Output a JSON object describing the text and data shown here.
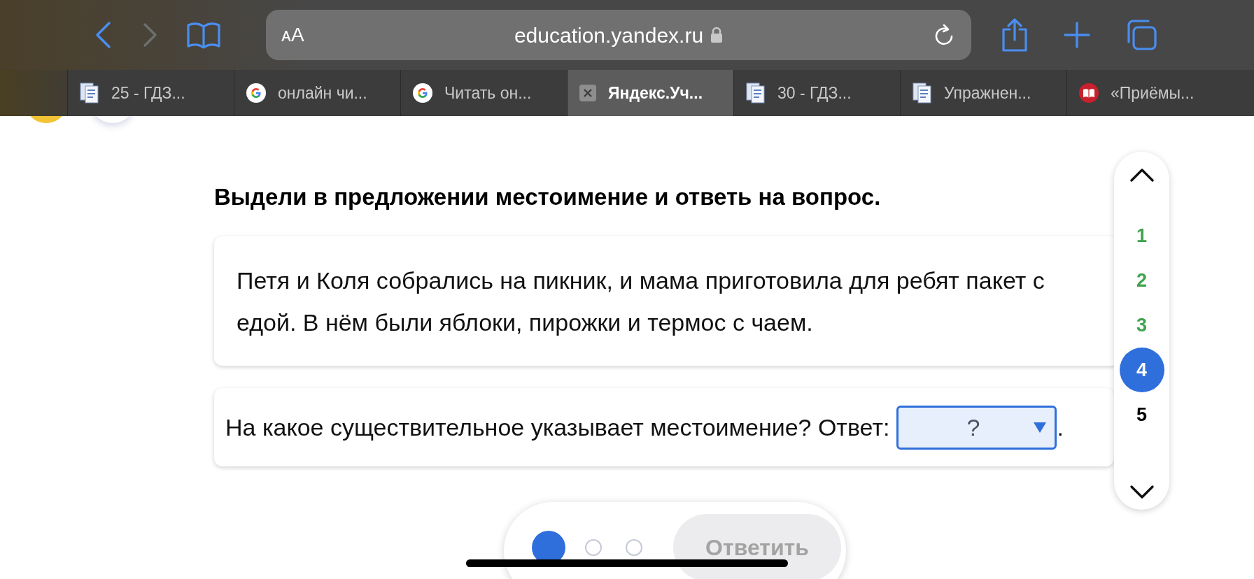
{
  "browser": {
    "text_size_button": "ᴀA",
    "url": "education.yandex.ru",
    "tabs": [
      {
        "title": "25 - ГДЗ...",
        "kind": "doc",
        "selected": false
      },
      {
        "title": "онлайн чи...",
        "kind": "google",
        "selected": false
      },
      {
        "title": "Читать он...",
        "kind": "google",
        "selected": false
      },
      {
        "title": "Яндекс.Уч...",
        "kind": "close",
        "selected": true
      },
      {
        "title": "30 - ГДЗ...",
        "kind": "doc",
        "selected": false
      },
      {
        "title": "Упражнен...",
        "kind": "doc",
        "selected": false
      },
      {
        "title": "«Приёмы...",
        "kind": "book",
        "selected": false
      }
    ]
  },
  "task": {
    "instruction": "Выдели в предложении местоимение и ответь на вопрос.",
    "passage": "Петя и Коля собрались на пикник, и мама приготовила для ребят пакет с едой. В нём были яблоки, пирожки и термос с чаем.",
    "question": "На какое существительное указывает местоимение? Ответ:",
    "answer": {
      "value": "?"
    },
    "after": "."
  },
  "task_nav": [
    {
      "label": "1",
      "done": true,
      "selected": false
    },
    {
      "label": "2",
      "done": true,
      "selected": false
    },
    {
      "label": "3",
      "done": true,
      "selected": false
    },
    {
      "label": "4",
      "done": false,
      "selected": true
    },
    {
      "label": "5",
      "done": false,
      "selected": false
    }
  ],
  "steps": [
    {
      "selected": true
    },
    {
      "selected": false
    },
    {
      "selected": false
    }
  ],
  "submit": {
    "label": "Ответить",
    "disabled": true
  }
}
